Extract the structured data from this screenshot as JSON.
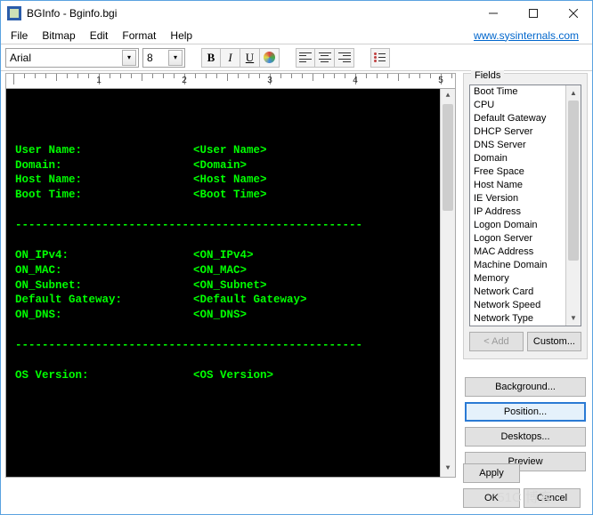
{
  "window": {
    "title": "BGInfo - Bginfo.bgi"
  },
  "menu": {
    "file": "File",
    "bitmap": "Bitmap",
    "edit": "Edit",
    "format": "Format",
    "help": "Help",
    "link": "www.sysinternals.com"
  },
  "toolbar": {
    "font": "Arial",
    "size": "8",
    "bold": "B",
    "italic": "I",
    "underline": "U"
  },
  "ruler": {
    "marks": [
      "1",
      "2",
      "3",
      "4",
      "5"
    ]
  },
  "editor": {
    "rows": [
      {
        "label": "User Name:",
        "value": "<User Name>"
      },
      {
        "label": "Domain:",
        "value": "<Domain>"
      },
      {
        "label": "Host Name:",
        "value": "<Host Name>"
      },
      {
        "label": "Boot Time:",
        "value": "<Boot Time>"
      }
    ],
    "rows2": [
      {
        "label": "ON_IPv4:",
        "value": "<ON_IPv4>"
      },
      {
        "label": "ON_MAC:",
        "value": "<ON_MAC>"
      },
      {
        "label": "ON_Subnet:",
        "value": "<ON_Subnet>"
      },
      {
        "label": "Default Gateway:",
        "value": "<Default Gateway>"
      },
      {
        "label": "ON_DNS:",
        "value": "<ON_DNS>"
      }
    ],
    "rows3": [
      {
        "label": "OS Version:",
        "value": "<OS Version>"
      }
    ],
    "divider": "----------------------------------------------------"
  },
  "fields": {
    "title": "Fields",
    "items": [
      "Boot Time",
      "CPU",
      "Default Gateway",
      "DHCP Server",
      "DNS Server",
      "Domain",
      "Free Space",
      "Host Name",
      "IE Version",
      "IP Address",
      "Logon Domain",
      "Logon Server",
      "MAC Address",
      "Machine Domain",
      "Memory",
      "Network Card",
      "Network Speed",
      "Network Type"
    ],
    "add": "< Add",
    "custom": "Custom..."
  },
  "side": {
    "background": "Background...",
    "position": "Position...",
    "desktops": "Desktops...",
    "preview": "Preview"
  },
  "bottom": {
    "apply": "Apply",
    "ok": "OK",
    "cancel": "Cancel"
  },
  "watermark": "51C 博客"
}
